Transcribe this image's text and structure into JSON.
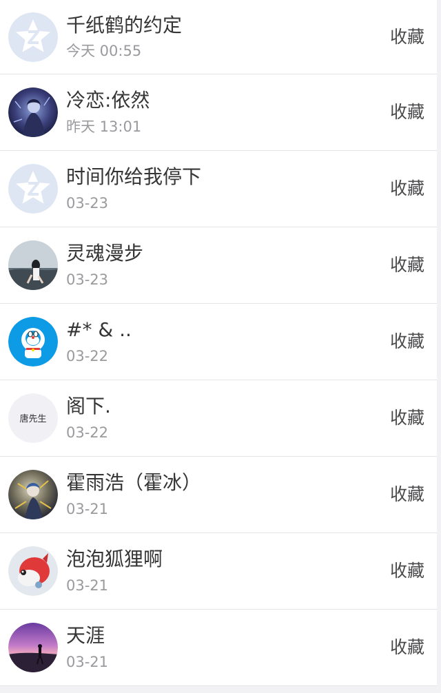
{
  "visitors": [
    {
      "name": "千纸鹤的约定",
      "time": "今天 00:55",
      "action": "收藏",
      "avatar_icon": "qzone-star-icon"
    },
    {
      "name": "冷恋:依然",
      "time": "昨天 13:01",
      "action": "收藏",
      "avatar_icon": "anime-avatar"
    },
    {
      "name": "时间你给我停下",
      "time": "03-23",
      "action": "收藏",
      "avatar_icon": "qzone-star-icon"
    },
    {
      "name": "灵魂漫步",
      "time": "03-23",
      "action": "收藏",
      "avatar_icon": "photo-avatar"
    },
    {
      "name": "#* & ..",
      "time": "03-22",
      "action": "收藏",
      "avatar_icon": "doraemon-avatar"
    },
    {
      "name": "阁下.",
      "time": "03-22",
      "action": "收藏",
      "avatar_icon": "text-avatar",
      "avatar_text": "唐先生"
    },
    {
      "name": "霍雨浩（霍冰）",
      "time": "03-21",
      "action": "收藏",
      "avatar_icon": "anime-avatar"
    },
    {
      "name": "泡泡狐狸啊",
      "time": "03-21",
      "action": "收藏",
      "avatar_icon": "fox-avatar"
    },
    {
      "name": "天涯",
      "time": "03-21",
      "action": "收藏",
      "avatar_icon": "sunset-avatar"
    }
  ],
  "colors": {
    "name_text": "#353535",
    "time_text": "#9a9a9e",
    "action_text": "#4a4a4c",
    "divider": "#e4e4e6",
    "qzone_avatar_bg": "#dde6f2"
  }
}
